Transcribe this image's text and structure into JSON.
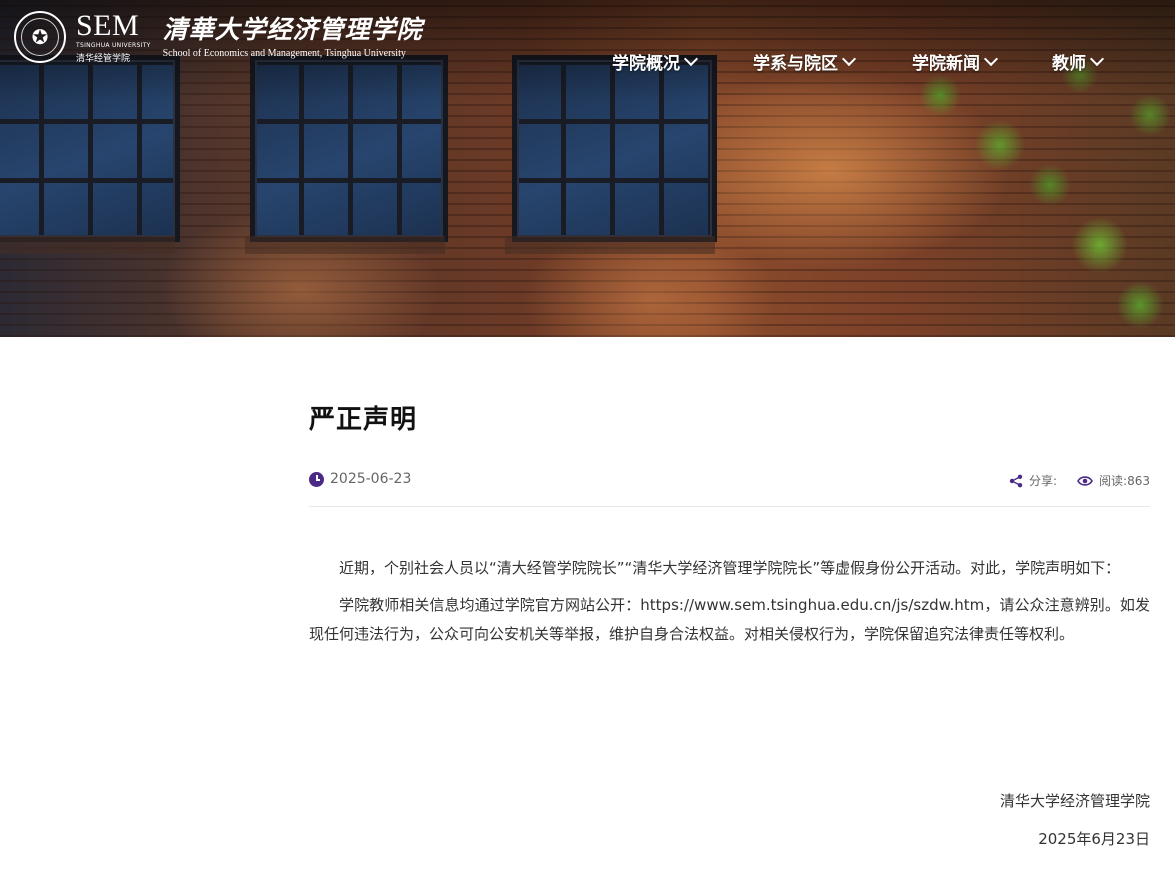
{
  "header": {
    "logo": {
      "sem": "SEM",
      "sem_university": "TSINGHUA UNIVERSITY",
      "sem_chinese": "清华经管学院",
      "chinese_name": "清華大学经济管理学院",
      "english_name": "School of Economics and Management, Tsinghua University",
      "seal_icon": "tsinghua-seal-icon"
    },
    "nav": [
      {
        "label": "学院概况",
        "icon": "chevron-down-icon"
      },
      {
        "label": "学系与院区",
        "icon": "chevron-down-icon"
      },
      {
        "label": "学院新闻",
        "icon": "chevron-down-icon"
      },
      {
        "label": "教师",
        "icon": "chevron-down-icon"
      }
    ]
  },
  "article": {
    "title": "严正声明",
    "date": "2025-06-23",
    "share_label": "分享:",
    "reads_label": "阅读:",
    "reads_count": "863",
    "paragraphs": [
      "近期，个别社会人员以“清大经管学院院长”“清华大学经济管理学院院长”等虚假身份公开活动。对此，学院声明如下：",
      "学院教师相关信息均通过学院官方网站公开：https://www.sem.tsinghua.edu.cn/js/szdw.htm，请公众注意辨别。如发现任何违法行为，公众可向公安机关等举报，维护自身合法权益。对相关侵权行为，学院保留追究法律责任等权利。"
    ],
    "signature": "清华大学经济管理学院",
    "signature_date": "2025年6月23日"
  },
  "colors": {
    "accent": "#4a2a86",
    "title": "#111111",
    "body_text": "#333333",
    "meta_text": "#666666"
  }
}
